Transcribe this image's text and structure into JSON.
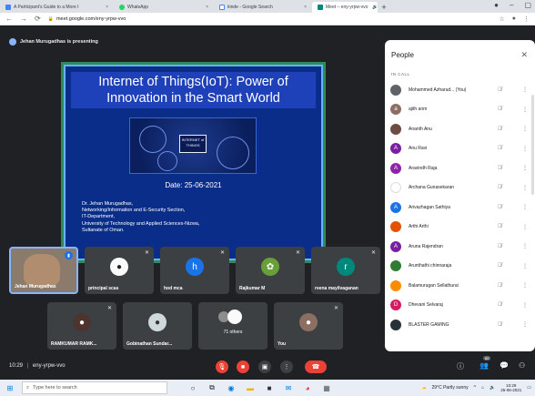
{
  "browser": {
    "tabs": [
      {
        "label": "A Participant's Guide to a More I",
        "close": "×"
      },
      {
        "label": "WhatsApp",
        "close": "×"
      },
      {
        "label": "kinde - Google Search",
        "close": "×"
      },
      {
        "label": "Meet – eny-yrpw-vvo",
        "audio": "🔊",
        "close": "×"
      }
    ],
    "new_tab": "+",
    "url": "meet.google.com/eny-yrpw-vvo"
  },
  "meet": {
    "presenter_text": "Jehan Murugadhas is presenting",
    "slide": {
      "title_line1": "Internet of Things(IoT): Power of",
      "title_line2": "Innovation in the Smart World",
      "graphic_label": "INTERNET of THINGS",
      "date": "Date: 25-06-2021",
      "info": [
        "Dr. Jehan Murugadhas,",
        "Networking/Information and E-Security Section,",
        "IT-Department,",
        "University of Technology and Applied Sciences-Nizwa,",
        "Sultanate of Oman."
      ]
    },
    "tiles_row1": [
      {
        "name": "Jehan Murugadhas"
      },
      {
        "name": "principal scas"
      },
      {
        "name": "hod mca",
        "initial": "h"
      },
      {
        "name": "Rajkumar M"
      },
      {
        "name": "reena mayilvaganan",
        "initial": "r"
      }
    ],
    "tiles_row2": [
      {
        "name": "RAMKUMAR RAMK..."
      },
      {
        "name": "Gobinathan Sundar..."
      },
      {
        "name": "71 others"
      },
      {
        "name": "You"
      }
    ],
    "meeting_time": "10:29",
    "meeting_code": "eny-yrpw-vvo",
    "people_badge": "80"
  },
  "people_panel": {
    "title": "People",
    "section": "IN CALL",
    "participants": [
      {
        "name": "Mohammed Azharud... (You)",
        "color": "#5f6368",
        "initial": ""
      },
      {
        "name": "ajith anm",
        "color": "#8d6e63",
        "initial": "a"
      },
      {
        "name": "Ananth Anu",
        "color": "#6d4c41",
        "initial": ""
      },
      {
        "name": "Anu Ravi",
        "color": "#7b1fa2",
        "initial": "A"
      },
      {
        "name": "Aravindh Raja",
        "color": "#8e24aa",
        "initial": "A"
      },
      {
        "name": "Archana Gunasekaran",
        "color": "#ffffff",
        "initial": ""
      },
      {
        "name": "Arivazhagan Sathiya",
        "color": "#1a73e8",
        "initial": "A"
      },
      {
        "name": "Arthi Arthi",
        "color": "#e65100",
        "initial": ""
      },
      {
        "name": "Aruna Rajendran",
        "color": "#7b1fa2",
        "initial": "A"
      },
      {
        "name": "Arunthathi chinnaraja",
        "color": "#2e7d32",
        "initial": ""
      },
      {
        "name": "Balamurugan Sellathurai",
        "color": "#fb8c00",
        "initial": ""
      },
      {
        "name": "Dhevani Selvaraj",
        "color": "#d81b60",
        "initial": "D"
      },
      {
        "name": "BLASTER GAMING",
        "color": "#263238",
        "initial": ""
      }
    ]
  },
  "taskbar": {
    "search_placeholder": "Type here to search",
    "weather": "29°C Partly sunny",
    "time": "10:29",
    "date": "25-06-2021"
  }
}
